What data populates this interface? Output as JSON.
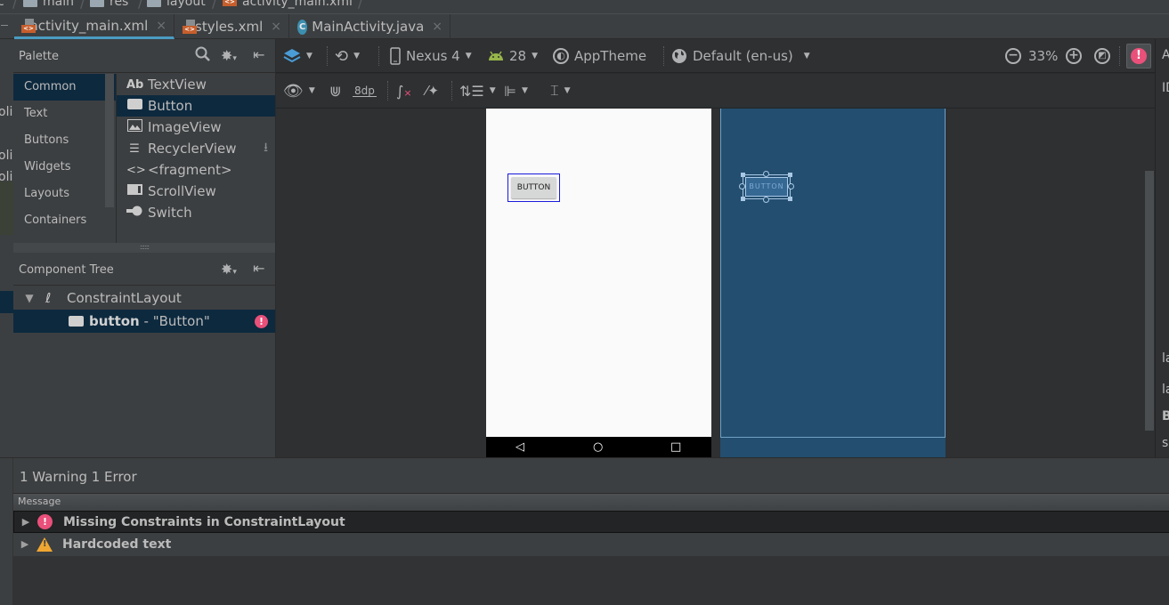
{
  "breadcrumb": {
    "items": [
      {
        "label": "c",
        "icon": "none"
      },
      {
        "label": "main",
        "icon": "folder-icon"
      },
      {
        "label": "res",
        "icon": "resource-folder-icon"
      },
      {
        "label": "layout",
        "icon": "folder-icon"
      },
      {
        "label": "activity_main.xml",
        "icon": "xml-file-icon"
      }
    ]
  },
  "tabs": [
    {
      "label": "activity_main.xml",
      "icon": "xml-file-icon",
      "active": true
    },
    {
      "label": "styles.xml",
      "icon": "xml-file-icon",
      "active": false
    },
    {
      "label": "MainActivity.java",
      "icon": "java-class-icon",
      "active": false
    }
  ],
  "tab_close_glyph": "×",
  "palette": {
    "title": "Palette",
    "categories": [
      "Common",
      "Text",
      "Buttons",
      "Widgets",
      "Layouts",
      "Containers"
    ],
    "selected_category": "Common",
    "widgets": [
      {
        "label": "TextView",
        "icon": "Ab"
      },
      {
        "label": "Button",
        "icon": "button-shape"
      },
      {
        "label": "ImageView",
        "icon": "image"
      },
      {
        "label": "RecyclerView",
        "icon": "list"
      },
      {
        "label": "<fragment>",
        "icon": "code"
      },
      {
        "label": "ScrollView",
        "icon": "scroll"
      },
      {
        "label": "Switch",
        "icon": "switch"
      }
    ],
    "selected_widget": "Button",
    "splitter_glyph": "::::::"
  },
  "component_tree": {
    "title": "Component Tree",
    "root": "ConstraintLayout",
    "child_id": "button",
    "child_text": " - \"Button\"",
    "child_error_glyph": "!"
  },
  "toolbar": {
    "device": "Nexus 4",
    "api_level": "28",
    "theme": "AppTheme",
    "locale": "Default (en-us)",
    "zoom": "33%",
    "default_margin": "8dp",
    "error_glyph": "!"
  },
  "design": {
    "button_text": "BUTTON",
    "blueprint_button_text": "BUTTON",
    "nav_back": "◁",
    "nav_home": "○",
    "nav_recent": "□"
  },
  "attributes_strip": [
    "A",
    "ID",
    "la",
    "la",
    "B",
    "s"
  ],
  "left_gutter_fragments": [
    "oli",
    "oli",
    "oli"
  ],
  "messages": {
    "summary": "1 Warning 1 Error",
    "column_header": "Message",
    "items": [
      {
        "severity": "error",
        "text": "Missing Constraints in ConstraintLayout"
      },
      {
        "severity": "warning",
        "text": "Hardcoded text"
      }
    ]
  },
  "colors": {
    "accent": "#4a9cc2",
    "error": "#e9507a",
    "warning": "#f0a732",
    "blueprint": "#234e6f",
    "selection": "#0d293e"
  }
}
